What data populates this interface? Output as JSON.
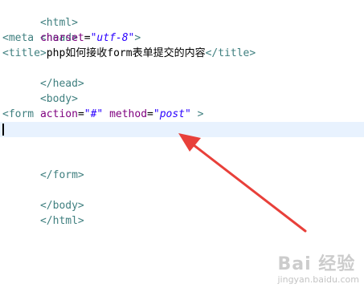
{
  "editor": {
    "lines": [
      {
        "tag_open": "<html>"
      },
      {
        "tag_open": "<head>"
      },
      {
        "meta_open": "<meta ",
        "meta_attr": "charset",
        "meta_eq": "=",
        "meta_val": "\"utf-8\"",
        "meta_close": ">"
      },
      {
        "title_open": "<title>",
        "title_text": "php如何接收form表单提交的内容",
        "title_close": "</title>"
      },
      {
        "tag_open": "</head>"
      },
      {
        "tag_open": "<body>"
      },
      {
        "blank": ""
      },
      {
        "form_open": "<form ",
        "action_attr": "action",
        "action_eq": "=",
        "action_val": "\"#\"",
        "method_attr": "method",
        "method_eq": "=",
        "method_val": "\"post\"",
        "form_close": " >"
      },
      {
        "active": true
      },
      {
        "blank": ""
      },
      {
        "tag_open": "</form>"
      },
      {
        "blank": ""
      },
      {
        "tag_open": "</body>"
      },
      {
        "tag_open": "</html>"
      }
    ]
  },
  "colors": {
    "tag": "#3f7f7f",
    "attribute": "#7f007f",
    "value": "#2a00ff",
    "active_line": "#e8f2fe",
    "arrow": "#e8403a"
  },
  "annotation": {
    "icon": "red-arrow-icon"
  },
  "watermark": {
    "brand": "Bai 经验",
    "url": "jingyan.baidu.com"
  }
}
